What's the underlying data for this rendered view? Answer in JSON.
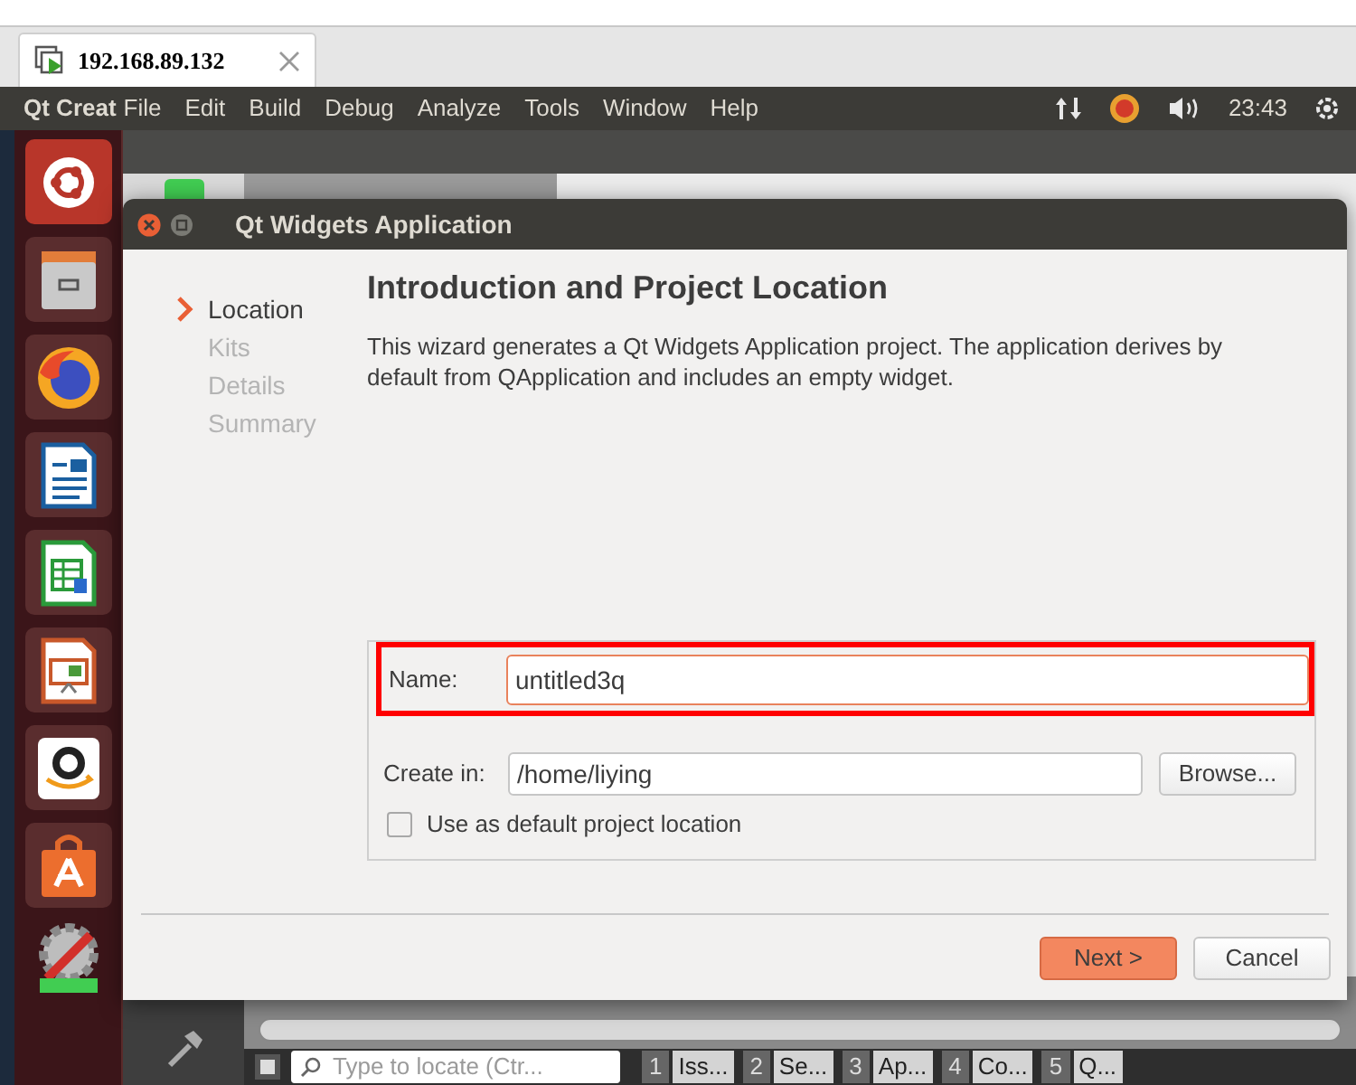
{
  "browser_tab": {
    "title": "192.168.89.132"
  },
  "top_panel": {
    "app_name": "Qt Creat",
    "menu": [
      "File",
      "Edit",
      "Build",
      "Debug",
      "Analyze",
      "Tools",
      "Window",
      "Help"
    ],
    "clock": "23:43"
  },
  "dialog": {
    "title": "Qt Widgets Application",
    "steps": [
      {
        "label": "Location",
        "selected": true
      },
      {
        "label": "Kits",
        "selected": false
      },
      {
        "label": "Details",
        "selected": false
      },
      {
        "label": "Summary",
        "selected": false
      }
    ],
    "heading": "Introduction and Project Location",
    "description": "This wizard generates a Qt Widgets Application project. The application derives by default from QApplication and includes an empty widget.",
    "name_field": {
      "label": "Name:",
      "value": "untitled3q",
      "focused": true
    },
    "location_field": {
      "label": "Create in:",
      "value": "/home/liying",
      "focused": false
    },
    "browse_button": "Browse...",
    "default_location": {
      "label": "Use as default project location",
      "checked": false
    },
    "buttons": [
      {
        "label": "Next >",
        "default": true
      },
      {
        "label": "Cancel",
        "default": false
      }
    ]
  },
  "locator": {
    "placeholder": "Type to locate (Ctr..."
  },
  "output_panes": [
    {
      "number": "1",
      "label": "Iss..."
    },
    {
      "number": "2",
      "label": "Se..."
    },
    {
      "number": "3",
      "label": "Ap..."
    },
    {
      "number": "4",
      "label": "Co..."
    },
    {
      "number": "5",
      "label": "Q..."
    }
  ]
}
